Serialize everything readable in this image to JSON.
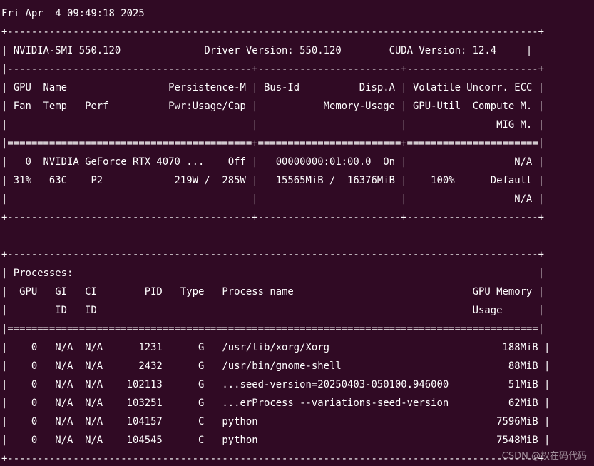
{
  "terminal": {
    "lines": [
      "Fri Apr  4 09:49:18 2025",
      "+-----------------------------------------------------------------------------------------+",
      "| NVIDIA-SMI 550.120              Driver Version: 550.120        CUDA Version: 12.4     |",
      "|-----------------------------------------+------------------------+----------------------+",
      "| GPU  Name                 Persistence-M | Bus-Id          Disp.A | Volatile Uncorr. ECC |",
      "| Fan  Temp   Perf          Pwr:Usage/Cap |           Memory-Usage | GPU-Util  Compute M. |",
      "|                                         |                        |               MIG M. |",
      "|=========================================+========================+======================|",
      "|   0  NVIDIA GeForce RTX 4070 ...    Off |   00000000:01:00.0  On |                  N/A |",
      "| 31%   63C    P2            219W /  285W |   15565MiB /  16376MiB |    100%      Default |",
      "|                                         |                        |                  N/A |",
      "+-----------------------------------------+------------------------+----------------------+",
      "",
      "+-----------------------------------------------------------------------------------------+",
      "| Processes:                                                                              |",
      "|  GPU   GI   CI        PID   Type   Process name                              GPU Memory |",
      "|        ID   ID                                                               Usage      |",
      "|=========================================================================================|",
      "|    0   N/A  N/A      1231      G   /usr/lib/xorg/Xorg                             188MiB |",
      "|    0   N/A  N/A      2432      G   /usr/bin/gnome-shell                            88MiB |",
      "|    0   N/A  N/A    102113      G   ...seed-version=20250403-050100.946000          51MiB |",
      "|    0   N/A  N/A    103251      G   ...erProcess --variations-seed-version          62MiB |",
      "|    0   N/A  N/A    104157      C   python                                        7596MiB |",
      "|    0   N/A  N/A    104545      C   python                                        7548MiB |",
      "+-----------------------------------------------------------------------------------------+"
    ]
  },
  "watermark": "CSDN @权在码代码",
  "colors": {
    "background": "#300a24",
    "foreground": "#ffffff"
  }
}
